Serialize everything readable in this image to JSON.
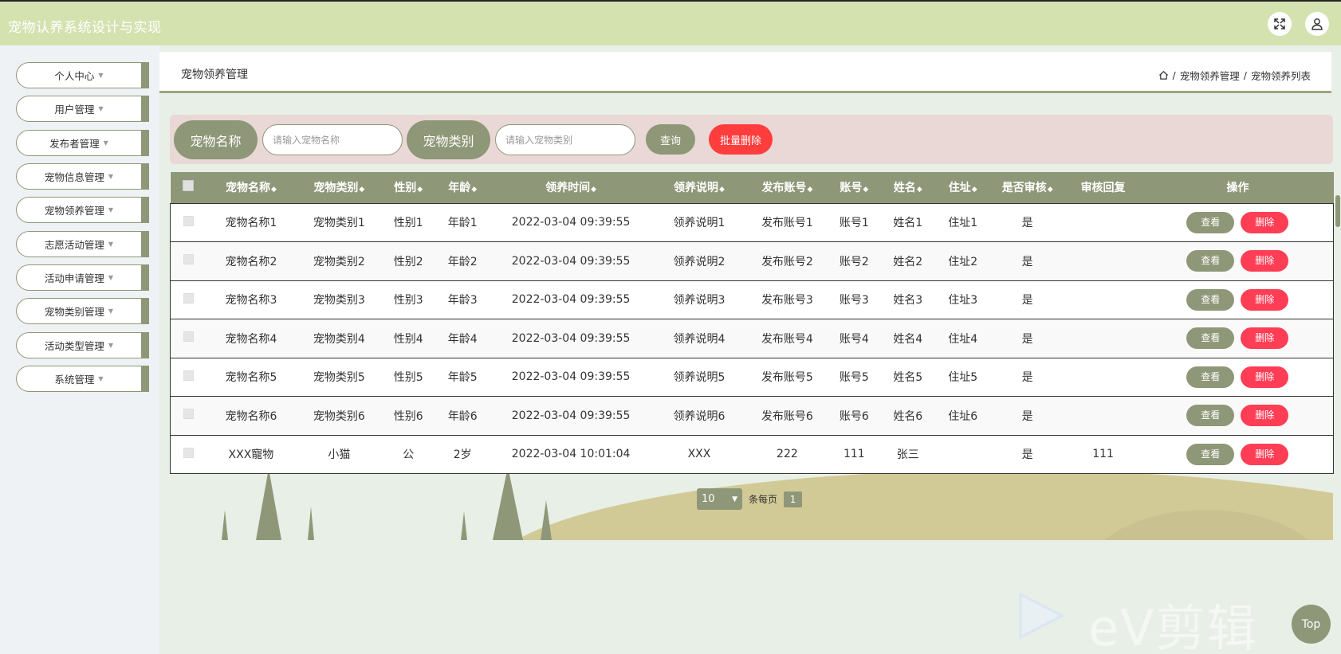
{
  "app": {
    "title": "宠物认养系统设计与实现"
  },
  "sidebar": {
    "items": [
      {
        "label": "个人中心"
      },
      {
        "label": "用户管理"
      },
      {
        "label": "发布者管理"
      },
      {
        "label": "宠物信息管理"
      },
      {
        "label": "宠物领养管理"
      },
      {
        "label": "志愿活动管理"
      },
      {
        "label": "活动申请管理"
      },
      {
        "label": "宠物类别管理"
      },
      {
        "label": "活动类型管理"
      },
      {
        "label": "系统管理"
      }
    ]
  },
  "panel": {
    "title": "宠物领养管理",
    "breadcrumb": [
      "宠物领养管理",
      "宠物领养列表"
    ]
  },
  "search": {
    "name_label": "宠物名称",
    "name_placeholder": "请输入宠物名称",
    "type_label": "宠物类别",
    "type_placeholder": "请输入宠物类别",
    "query_label": "查询",
    "batch_delete_label": "批量删除"
  },
  "table": {
    "headers": [
      "宠物名称",
      "宠物类别",
      "性别",
      "年龄",
      "领养时间",
      "领养说明",
      "发布账号",
      "账号",
      "姓名",
      "住址",
      "是否审核",
      "审核回复",
      "操作"
    ],
    "rows": [
      [
        "宠物名称1",
        "宠物类别1",
        "性别1",
        "年龄1",
        "2022-03-04 09:39:55",
        "领养说明1",
        "发布账号1",
        "账号1",
        "姓名1",
        "住址1",
        "是",
        ""
      ],
      [
        "宠物名称2",
        "宠物类别2",
        "性别2",
        "年龄2",
        "2022-03-04 09:39:55",
        "领养说明2",
        "发布账号2",
        "账号2",
        "姓名2",
        "住址2",
        "是",
        ""
      ],
      [
        "宠物名称3",
        "宠物类别3",
        "性别3",
        "年龄3",
        "2022-03-04 09:39:55",
        "领养说明3",
        "发布账号3",
        "账号3",
        "姓名3",
        "住址3",
        "是",
        ""
      ],
      [
        "宠物名称4",
        "宠物类别4",
        "性别4",
        "年龄4",
        "2022-03-04 09:39:55",
        "领养说明4",
        "发布账号4",
        "账号4",
        "姓名4",
        "住址4",
        "是",
        ""
      ],
      [
        "宠物名称5",
        "宠物类别5",
        "性别5",
        "年龄5",
        "2022-03-04 09:39:55",
        "领养说明5",
        "发布账号5",
        "账号5",
        "姓名5",
        "住址5",
        "是",
        ""
      ],
      [
        "宠物名称6",
        "宠物类别6",
        "性别6",
        "年龄6",
        "2022-03-04 09:39:55",
        "领养说明6",
        "发布账号6",
        "账号6",
        "姓名6",
        "住址6",
        "是",
        ""
      ],
      [
        "XXX寵物",
        "小猫",
        "公",
        "2岁",
        "2022-03-04 10:01:04",
        "XXX",
        "222",
        "111",
        "张三",
        "",
        "是",
        "111"
      ]
    ],
    "view_label": "查看",
    "delete_label": "删除"
  },
  "pager": {
    "page_size": "10",
    "per_page_label": "条每页",
    "current_page": "1"
  },
  "watermark": {
    "text": "eV剪辑"
  },
  "top_button": {
    "label": "Top"
  },
  "colors": {
    "accent": "#8e9777",
    "header_bg": "#d4e2b0",
    "danger": "#ff3d55",
    "search_bg": "#e9d8d6"
  }
}
